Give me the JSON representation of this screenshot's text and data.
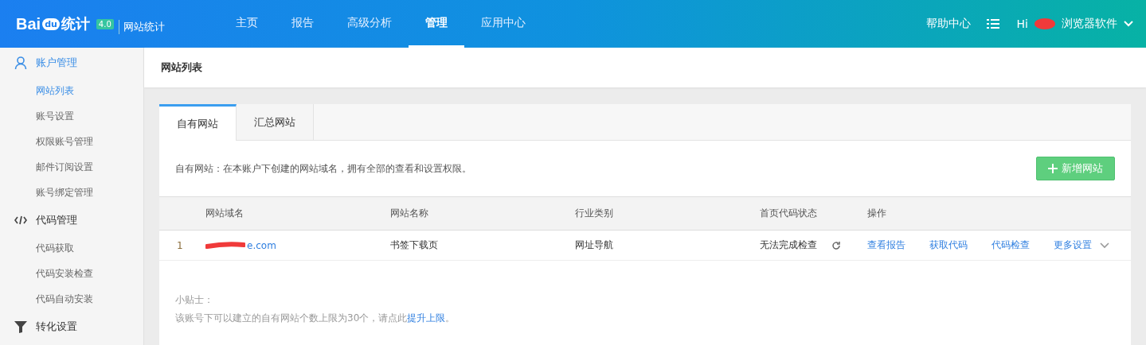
{
  "header": {
    "logo": {
      "bai": "Bai",
      "du": "du",
      "tongji": "统计",
      "version": "4.0",
      "product": "网站统计"
    },
    "nav": [
      {
        "label": "主页",
        "selected": false
      },
      {
        "label": "报告",
        "selected": false
      },
      {
        "label": "高级分析",
        "selected": false
      },
      {
        "label": "管理",
        "selected": true
      },
      {
        "label": "应用中心",
        "selected": false
      }
    ],
    "help": "帮助中心",
    "greeting": "Hi",
    "user": "浏览器软件"
  },
  "sidebar": [
    {
      "label": "账户管理",
      "children": [
        {
          "label": "网站列表",
          "selected": true
        },
        {
          "label": "账号设置",
          "selected": false
        },
        {
          "label": "权限账号管理",
          "selected": false
        },
        {
          "label": "邮件订阅设置",
          "selected": false
        },
        {
          "label": "账号绑定管理",
          "selected": false
        }
      ]
    },
    {
      "label": "代码管理",
      "children": [
        {
          "label": "代码获取",
          "selected": false
        },
        {
          "label": "代码安装检查",
          "selected": false
        },
        {
          "label": "代码自动安装",
          "selected": false
        }
      ]
    },
    {
      "label": "转化设置"
    }
  ],
  "page_title": "网站列表",
  "tabs": [
    {
      "label": "自有网站",
      "selected": true
    },
    {
      "label": "汇总网站",
      "selected": false
    }
  ],
  "description": "自有网站：在本账户下创建的网站域名，拥有全部的查看和设置权限。",
  "add_button": "新增网站",
  "table": {
    "columns": [
      "网站域名",
      "网站名称",
      "行业类别",
      "首页代码状态",
      "操作"
    ],
    "rows": [
      {
        "index": "1",
        "domain": "e.com",
        "name": "书签下载页",
        "industry": "网址导航",
        "status": "无法完成检查",
        "actions": [
          "查看报告",
          "获取代码",
          "代码检查",
          "更多设置"
        ]
      }
    ]
  },
  "tips": {
    "title": "小贴士：",
    "text": "该账号下可以建立的自有网站个数上限为30个，请点此",
    "link": "提升上限",
    "end": "。"
  }
}
